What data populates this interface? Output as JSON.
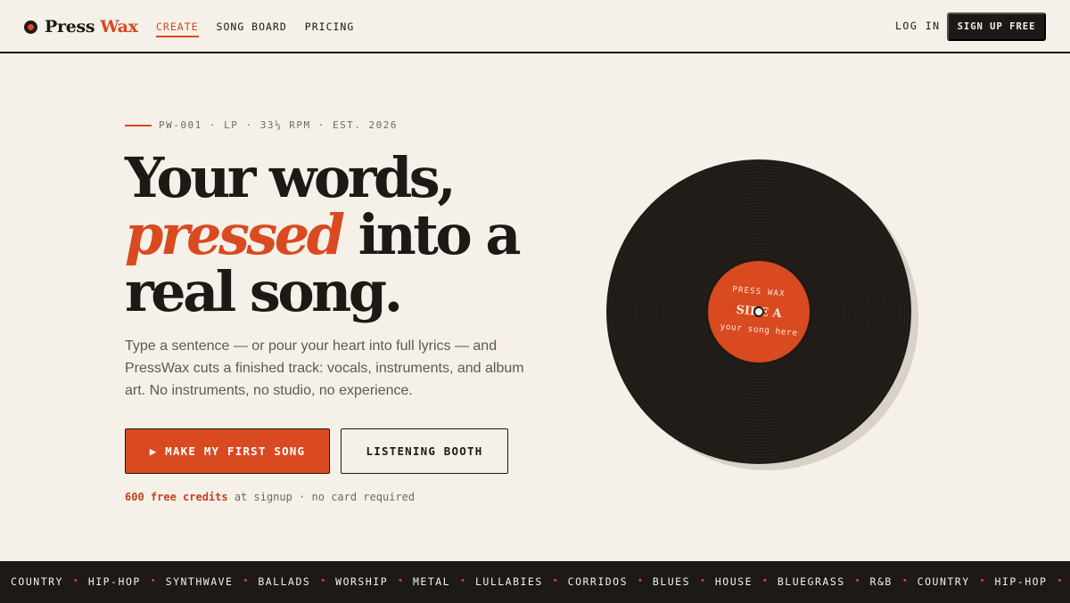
{
  "brand": {
    "name": "Press",
    "accent": "Wax",
    "accent_color": "#d94a20",
    "ink_color": "#1c1916",
    "paper_color": "#f5f0e8"
  },
  "nav": {
    "links": [
      {
        "label": "CREATE",
        "active": true
      },
      {
        "label": "SONG BOARD",
        "active": false
      },
      {
        "label": "PRICING",
        "active": false
      }
    ],
    "login_label": "LOG IN",
    "signup_label": "SIGN UP FREE"
  },
  "hero": {
    "eyebrow": "PW-001 · LP · 33⅓ RPM · EST. 2026",
    "headline_line1": "Your words,",
    "headline_em": "pressed",
    "headline_line2_rest": " into a",
    "headline_line3": "real song.",
    "lede": "Type a sentence — or pour your heart into full lyrics — and PressWax cuts a finished track: vocals, instruments, and album art. No instruments, no studio, no experience.",
    "primary_cta": "▶ MAKE MY FIRST SONG",
    "secondary_cta": "LISTENING BOOTH",
    "credits_strong": "600 free credits",
    "credits_rest": " at signup · no card required"
  },
  "record": {
    "label_top": "PRESS WAX",
    "label_mid": "SIDE A",
    "label_bottom": "your song here"
  },
  "ticker": {
    "genres": [
      "COUNTRY",
      "HIP-HOP",
      "SYNTHWAVE",
      "BALLADS",
      "WORSHIP",
      "METAL",
      "LULLABIES",
      "CORRIDOS",
      "BLUES",
      "HOUSE",
      "BLUEGRASS",
      "R&B",
      "COUNTRY",
      "HIP-HOP",
      "SYNTHWAVE"
    ],
    "separator": "•"
  }
}
